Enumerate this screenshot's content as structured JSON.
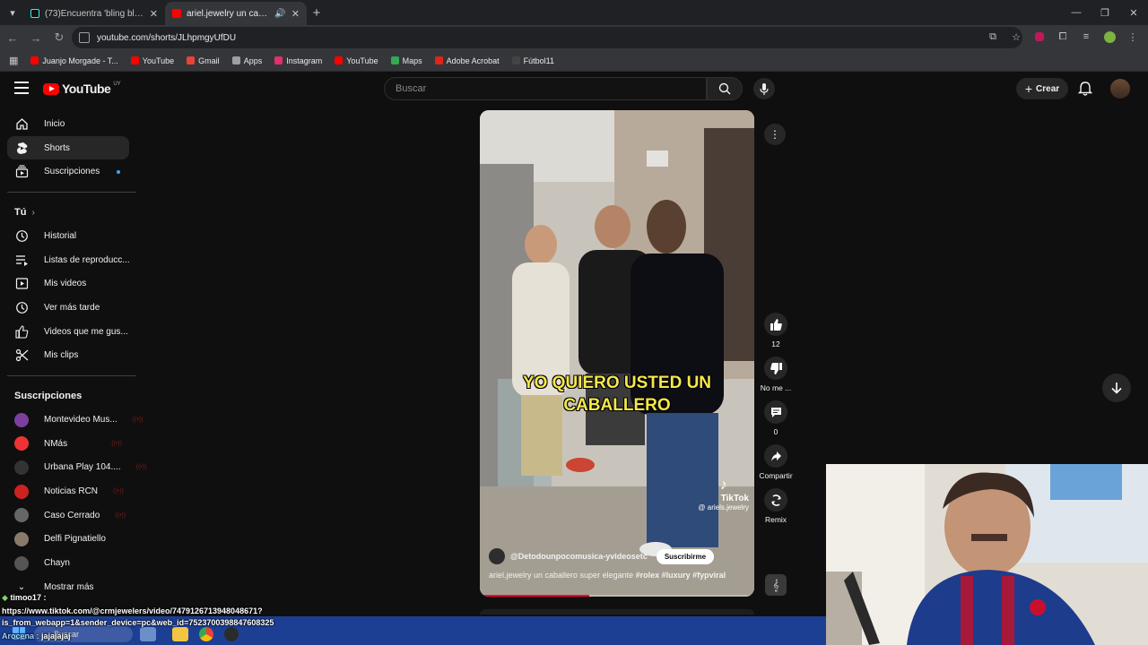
{
  "browser": {
    "tabs": [
      {
        "title": "(73)Encuentra 'bling bling' en TikTok",
        "active": false,
        "favicon_color": "#25f4ee"
      },
      {
        "title": "ariel.jewelry un caballero super elegante",
        "active": true,
        "favicon_color": "#ff0000"
      }
    ],
    "url": "youtube.com/shorts/JLhpmgyUfDU",
    "bookmarks": [
      {
        "label": "Juanjo Morgade - T...",
        "color": "#ff0000"
      },
      {
        "label": "YouTube",
        "color": "#ff0000"
      },
      {
        "label": "Gmail",
        "color": "#ea4335"
      },
      {
        "label": "Apps",
        "color": "#9aa0a6"
      },
      {
        "label": "Instagram",
        "color": "#e1306c"
      },
      {
        "label": "YouTube",
        "color": "#ff0000"
      },
      {
        "label": "Maps",
        "color": "#34a853"
      },
      {
        "label": "Adobe Acrobat",
        "color": "#e2231a"
      },
      {
        "label": "Fútbol11",
        "color": "#444444"
      }
    ]
  },
  "youtube": {
    "logo_text": "YouTube",
    "country_code": "UY",
    "search_placeholder": "Buscar",
    "create_label": "Crear",
    "nav": [
      {
        "label": "Inicio",
        "icon": "home-icon"
      },
      {
        "label": "Shorts",
        "icon": "shorts-icon",
        "active": true
      },
      {
        "label": "Suscripciones",
        "icon": "subscriptions-icon",
        "live_dot": true
      }
    ],
    "you_header": "Tú",
    "you_items": [
      {
        "label": "Historial",
        "icon": "history-icon"
      },
      {
        "label": "Listas de reproducc...",
        "icon": "playlists-icon"
      },
      {
        "label": "Mis videos",
        "icon": "my-videos-icon"
      },
      {
        "label": "Ver más tarde",
        "icon": "watch-later-icon"
      },
      {
        "label": "Videos que me gus...",
        "icon": "liked-videos-icon"
      },
      {
        "label": "Mis clips",
        "icon": "clips-icon"
      }
    ],
    "subs_header": "Suscripciones",
    "subscriptions": [
      {
        "label": "Montevideo Mus...",
        "color": "#7b3fa0",
        "live": true
      },
      {
        "label": "NMás",
        "color": "#e33",
        "live": true
      },
      {
        "label": "Urbana Play 104....",
        "color": "#333",
        "live": true
      },
      {
        "label": "Noticias RCN",
        "color": "#c22",
        "live": true
      },
      {
        "label": "Caso Cerrado",
        "color": "#666",
        "live": true
      },
      {
        "label": "Delfi Pignatiello",
        "color": "#8a7a6a",
        "live": false
      },
      {
        "label": "Chayn",
        "color": "#555",
        "live": false
      }
    ],
    "show_more": "Mostrar más",
    "short": {
      "caption": "YO QUIERO USTED UN CABALLERO",
      "tiktok_brand": "TikTok",
      "tiktok_handle": "@ ariels.jewelry",
      "channel": "@Detodounpocomusica-yvideosetc",
      "subscribe": "Suscribirme",
      "description_text": "ariel.jewelry un caballero super elegante",
      "hashtags": "#rolex #luxury #fypviral",
      "progress": 0.4
    },
    "actions": {
      "likes": "12",
      "dislike_label": "No me ...",
      "comments": "0",
      "share_label": "Compartir",
      "remix_label": "Remix"
    }
  },
  "overlay": {
    "chat_user": "timoo17 :",
    "link_line1": "https://www.tiktok.com/@crmjewelers/video/7479126713948048671?",
    "link_line2": "is_from_webapp=1&sender_device=pc&web_id=7523700398847608325",
    "chat_line3_user": "Arocena :",
    "chat_line3_msg": "jajajajaj",
    "taskbar_search": "Buscar"
  }
}
